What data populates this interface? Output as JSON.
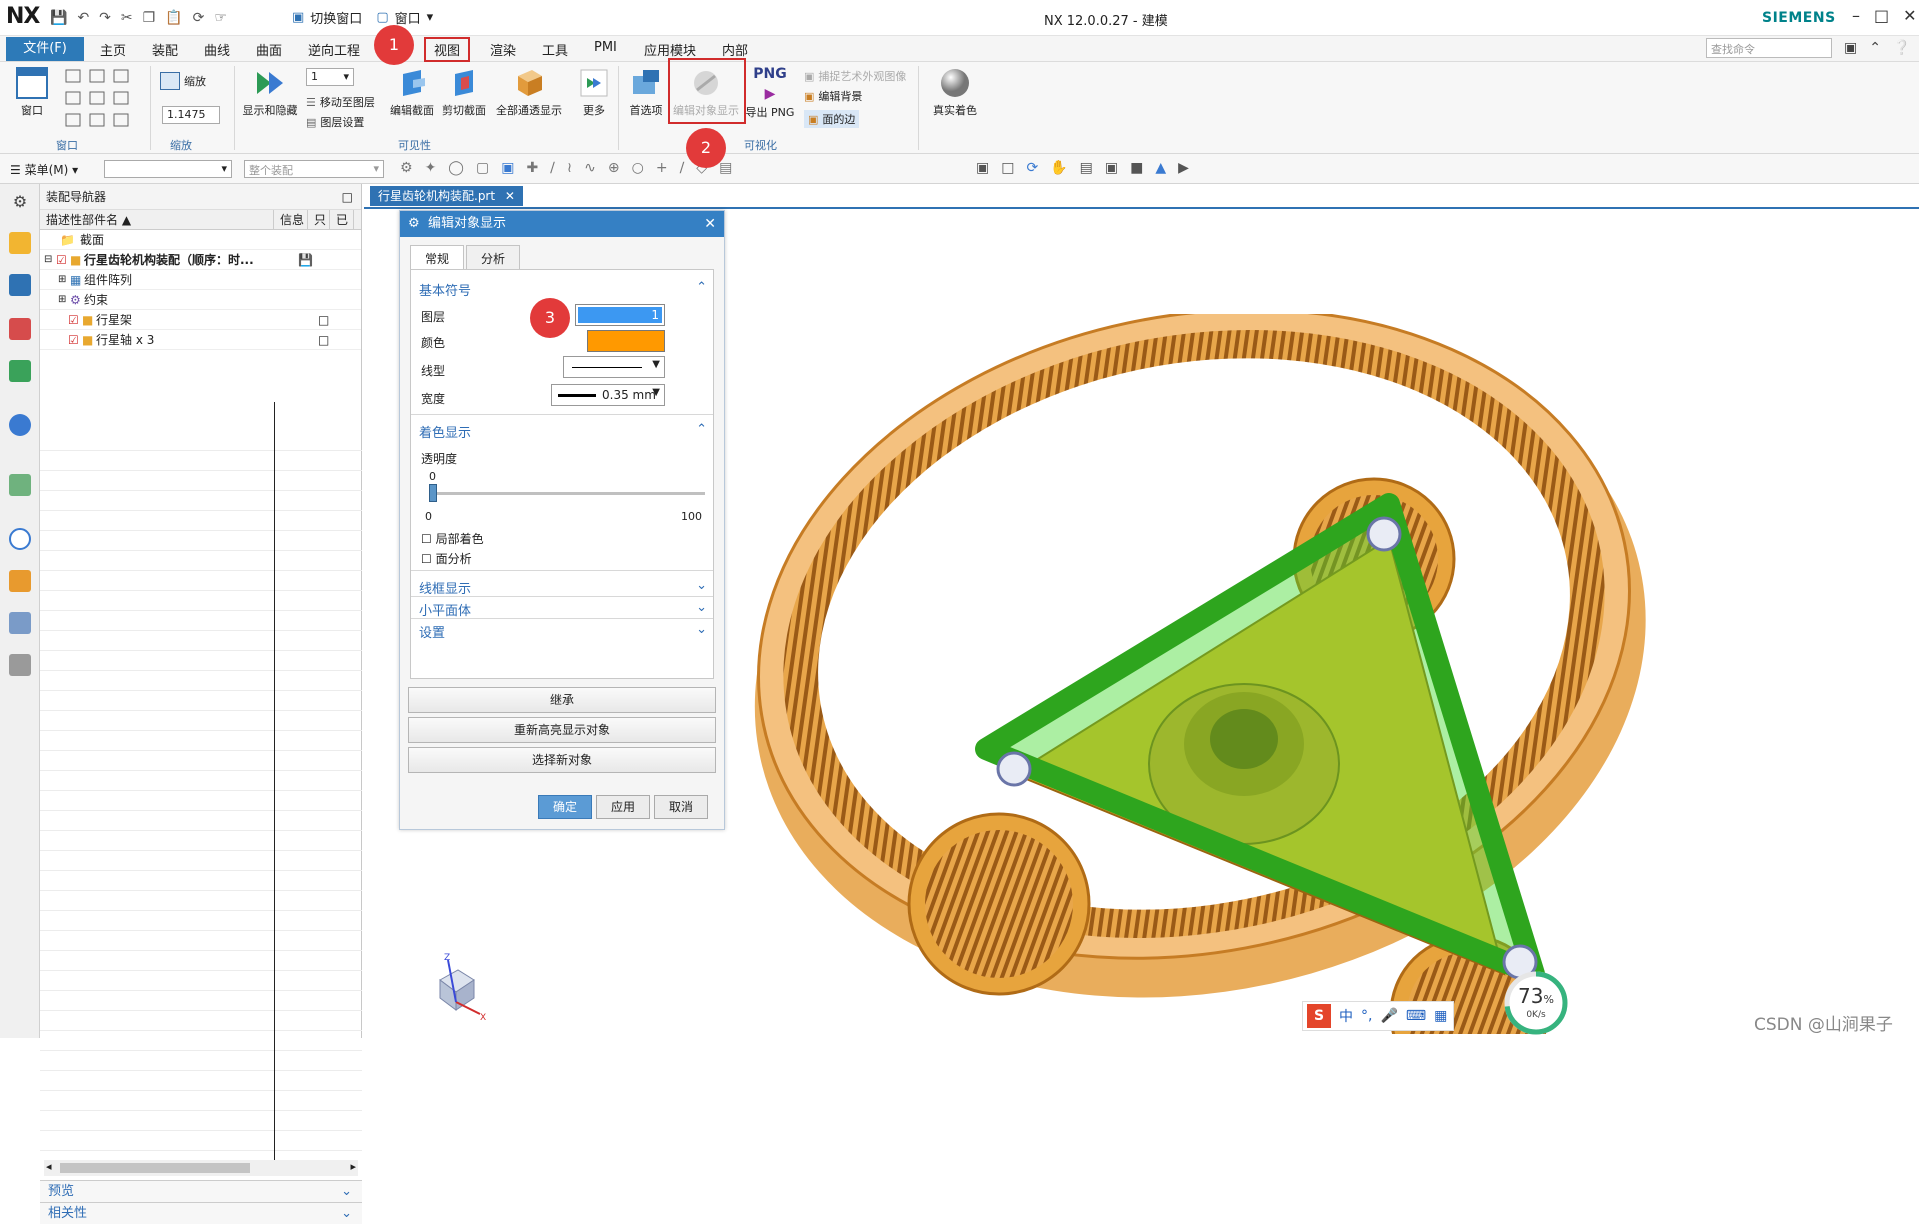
{
  "titlebar": {
    "logo": "NX",
    "switch_window": "切换窗口",
    "window_menu": "窗口",
    "title": "NX 12.0.0.27 - 建模",
    "brand": "SIEMENS"
  },
  "menubar": {
    "file": "文件(F)",
    "items": [
      "主页",
      "装配",
      "曲线",
      "曲面",
      "逆向工程",
      "视图",
      "渲染",
      "工具",
      "PMI",
      "应用模块",
      "内部"
    ],
    "search_placeholder": "查找命令"
  },
  "ribbon": {
    "window_group": {
      "label": "窗口",
      "button": "窗口"
    },
    "zoom_group": {
      "label": "缩放",
      "zoom_button": "缩放",
      "zoom_value": "1.1475"
    },
    "visibility_group": {
      "label": "可见性",
      "layer_value": "1",
      "show_hide": "显示和隐藏",
      "move_to_layer": "移动至图层",
      "layer_settings": "图层设置",
      "edit_section": "编辑截面",
      "clip_section": "剪切截面",
      "show_all": "全部通透显示",
      "more": "更多"
    },
    "visualization_group": {
      "label": "可视化",
      "preferences": "首选项",
      "edit_object_display": "编辑对象显示",
      "png_icon": "PNG",
      "export_png": "导出 PNG",
      "capture_art": "捕捉艺术外观图像",
      "edit_background": "编辑背景",
      "face_edges": "面的边",
      "true_shading": "真实着色"
    }
  },
  "toolbar2": {
    "menu": "菜单(M)",
    "filter_placeholder": "",
    "assembly_scope": "整个装配"
  },
  "navigator": {
    "title": "装配导航器",
    "columns": [
      "描述性部件名",
      "信息",
      "只",
      "已"
    ],
    "rows": [
      {
        "label": "截面",
        "indent": 1
      },
      {
        "label": "行星齿轮机构装配（顺序：时...",
        "indent": 0
      },
      {
        "label": "组件阵列",
        "indent": 2
      },
      {
        "label": "约束",
        "indent": 2
      },
      {
        "label": "行星架",
        "indent": 2
      },
      {
        "label": "行星轴 x 3",
        "indent": 2
      }
    ],
    "preview": "预览",
    "related": "相关性"
  },
  "graphics": {
    "tab": "行星齿轮机构装配.prt"
  },
  "dialog": {
    "title": "编辑对象显示",
    "tabs": [
      "常规",
      "分析"
    ],
    "basic_symbol": "基本符号",
    "layer_label": "图层",
    "layer_value": "1",
    "color_label": "颜色",
    "color_value": "#ff9900",
    "linetype_label": "线型",
    "width_label": "宽度",
    "width_value": "0.35 mm",
    "shading": "着色显示",
    "transparency_label": "透明度",
    "transparency_value": "0",
    "slider_min": "0",
    "slider_max": "100",
    "partial_shading": "局部着色",
    "face_analysis": "面分析",
    "wireframe": "线框显示",
    "facets": "小平面体",
    "settings": "设置",
    "inherit": "继承",
    "rehighlight": "重新高亮显示对象",
    "select_new": "选择新对象",
    "ok": "确定",
    "apply": "应用",
    "cancel": "取消"
  },
  "badges": [
    "1",
    "2",
    "3"
  ],
  "ime": {
    "lang": "中"
  },
  "gauge": {
    "percent": "73",
    "unit": "%",
    "speed": "0K/s"
  },
  "watermark": "CSDN @山涧果子",
  "colors": {
    "accent": "#2f72b3",
    "gear_orange": "#e89a2e",
    "carrier_green": "#3dd92f",
    "red": "#d12c2c"
  }
}
